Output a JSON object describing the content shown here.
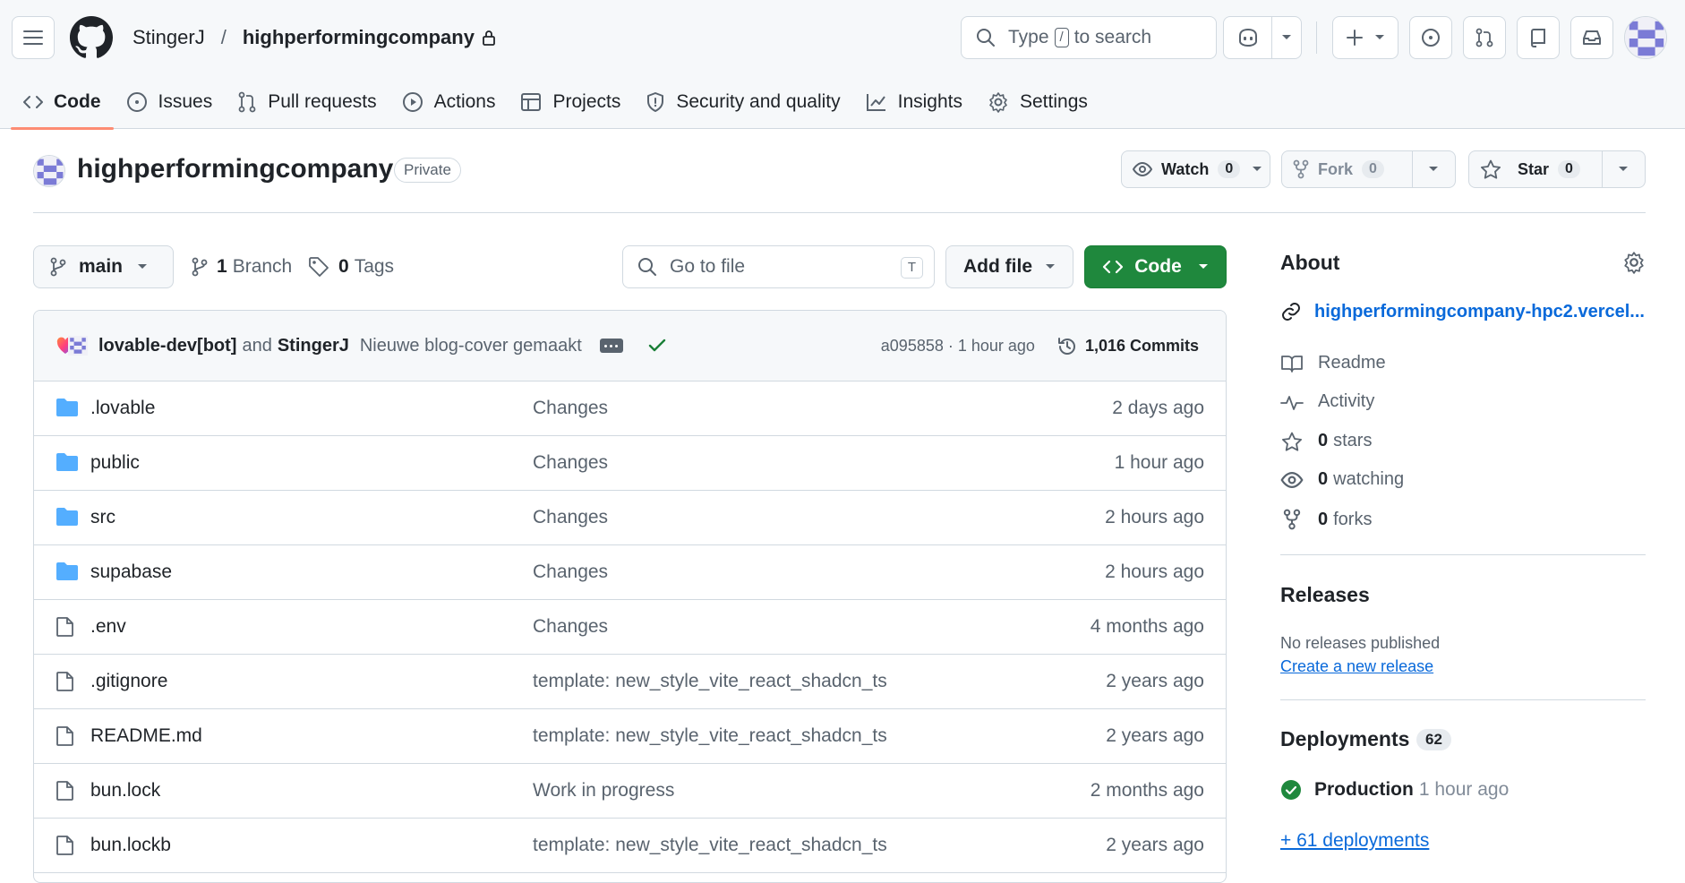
{
  "header": {
    "owner": "StingerJ",
    "separator": "/",
    "repo": "highperformingcompany",
    "search_prefix": "Type",
    "search_kbd": "/",
    "search_suffix": "to search"
  },
  "nav": {
    "tabs": [
      {
        "label": "Code",
        "icon": "code-icon",
        "active": true
      },
      {
        "label": "Issues",
        "icon": "issue-icon"
      },
      {
        "label": "Pull requests",
        "icon": "pull-request-icon"
      },
      {
        "label": "Actions",
        "icon": "play-icon"
      },
      {
        "label": "Projects",
        "icon": "table-icon"
      },
      {
        "label": "Security and quality",
        "icon": "shield-icon"
      },
      {
        "label": "Insights",
        "icon": "graph-icon"
      },
      {
        "label": "Settings",
        "icon": "gear-icon"
      }
    ]
  },
  "repo": {
    "title": "highperformingcompany",
    "visibility": "Private",
    "watch_label": "Watch",
    "watch_count": "0",
    "fork_label": "Fork",
    "fork_count": "0",
    "star_label": "Star",
    "star_count": "0"
  },
  "controls": {
    "branch": "main",
    "branch_count": "1",
    "branch_label": "Branch",
    "tag_count": "0",
    "tag_label": "Tags",
    "goto_placeholder": "Go to file",
    "goto_kbd": "T",
    "add_file": "Add file",
    "code": "Code"
  },
  "commit": {
    "author1": "lovable-dev[bot]",
    "and": "and",
    "author2": "StingerJ",
    "message": "Nieuwe blog-cover gemaakt",
    "sha_time": "a095858 · 1 hour ago",
    "commits": "1,016 Commits"
  },
  "files": [
    {
      "name": ".lovable",
      "type": "folder",
      "message": "Changes",
      "time": "2 days ago"
    },
    {
      "name": "public",
      "type": "folder",
      "message": "Changes",
      "time": "1 hour ago"
    },
    {
      "name": "src",
      "type": "folder",
      "message": "Changes",
      "time": "2 hours ago"
    },
    {
      "name": "supabase",
      "type": "folder",
      "message": "Changes",
      "time": "2 hours ago"
    },
    {
      "name": ".env",
      "type": "file",
      "message": "Changes",
      "time": "4 months ago"
    },
    {
      "name": ".gitignore",
      "type": "file",
      "message": "template: new_style_vite_react_shadcn_ts",
      "time": "2 years ago"
    },
    {
      "name": "README.md",
      "type": "file",
      "message": "template: new_style_vite_react_shadcn_ts",
      "time": "2 years ago"
    },
    {
      "name": "bun.lock",
      "type": "file",
      "message": "Work in progress",
      "time": "2 months ago"
    },
    {
      "name": "bun.lockb",
      "type": "file",
      "message": "template: new_style_vite_react_shadcn_ts",
      "time": "2 years ago"
    }
  ],
  "sidebar": {
    "about_heading": "About",
    "website": "highperformingcompany-hpc2.vercel...",
    "items": [
      {
        "icon": "book-icon",
        "count": "",
        "label": "Readme"
      },
      {
        "icon": "pulse-icon",
        "count": "",
        "label": "Activity"
      },
      {
        "icon": "star-icon",
        "count": "0",
        "label": "stars"
      },
      {
        "icon": "eye-icon",
        "count": "0",
        "label": "watching"
      },
      {
        "icon": "fork-icon",
        "count": "0",
        "label": "forks"
      }
    ],
    "releases_heading": "Releases",
    "no_releases": "No releases published",
    "create_release": "Create a new release",
    "deployments_heading": "Deployments",
    "deployments_count": "62",
    "deploy_name": "Production",
    "deploy_time": "1 hour ago",
    "more_deployments": "+ 61 deployments"
  },
  "colors": {
    "accent_green": "#1f883d",
    "link_blue": "#0969da",
    "folder_blue": "#54aeff",
    "active_tab": "#fd8c73"
  }
}
